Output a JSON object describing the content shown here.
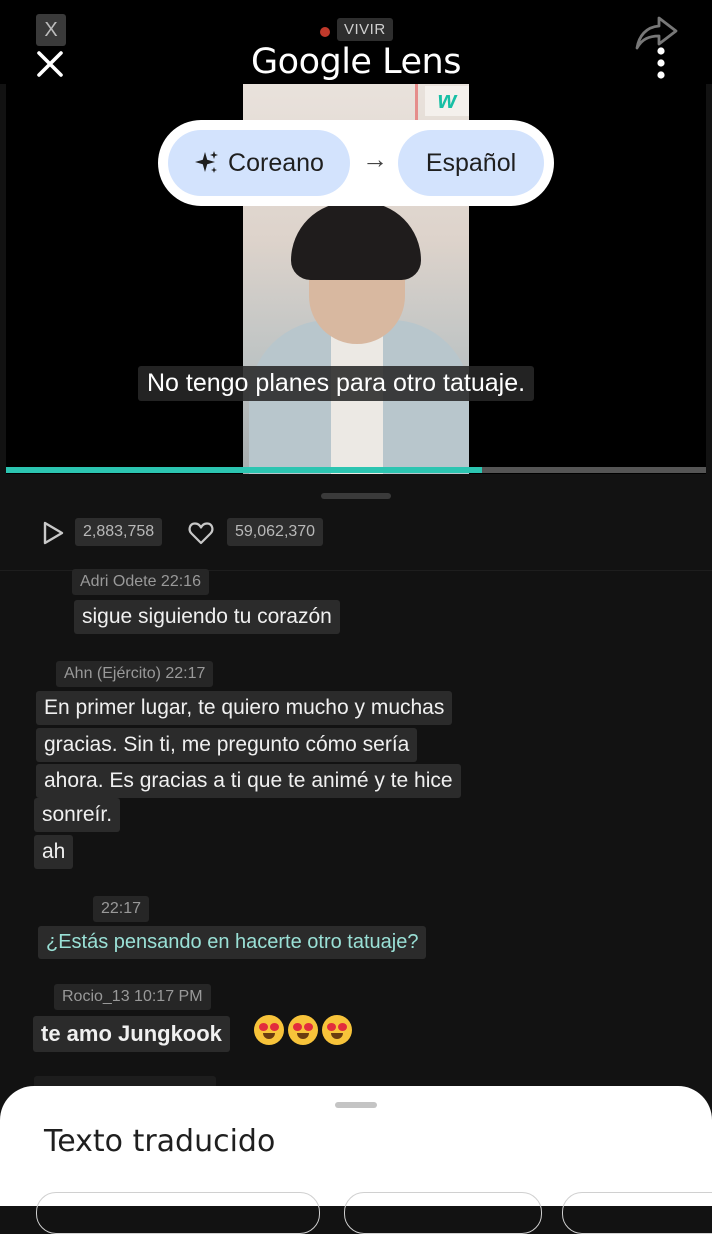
{
  "app": {
    "title": "Google Lens",
    "live_x": "X",
    "live_label": "VIVIR"
  },
  "translation": {
    "source_lang": "Coreano",
    "arrow": "→",
    "target_lang": "Español"
  },
  "video": {
    "logo": "w",
    "subtitle": "No tengo planes para otro tatuaje.",
    "progress": 0.68
  },
  "stats": {
    "plays": "2,883,758",
    "likes": "59,062,370"
  },
  "comments": [
    {
      "meta": "Adri Odete 22:16",
      "lines": [
        "sigue siguiendo tu corazón"
      ]
    },
    {
      "meta": "Ahn (Ejército) 22:17",
      "lines": [
        "En primer lugar, te quiero mucho y muchas",
        "gracias. Sin ti, me pregunto cómo sería",
        "ahora. Es gracias a ti que te animé y te hice",
        "sonreír.",
        "ah"
      ]
    },
    {
      "meta": "22:17",
      "lines": [
        "¿Estás pensando en hacerte otro tatuaje?"
      ]
    },
    {
      "meta": "Rocio_13 10:17 PM",
      "lines": [
        "te amo Jungkook"
      ]
    }
  ],
  "sheet": {
    "title": "Texto traducido"
  },
  "icons": {
    "close": "close-icon",
    "share": "share-icon",
    "more": "more-vert-icon",
    "sparkle": "sparkle-icon",
    "play": "play-icon",
    "heart": "heart-icon"
  },
  "colors": {
    "accent": "#2cc5b1",
    "chip": "#d3e3fd",
    "background": "#121212"
  }
}
